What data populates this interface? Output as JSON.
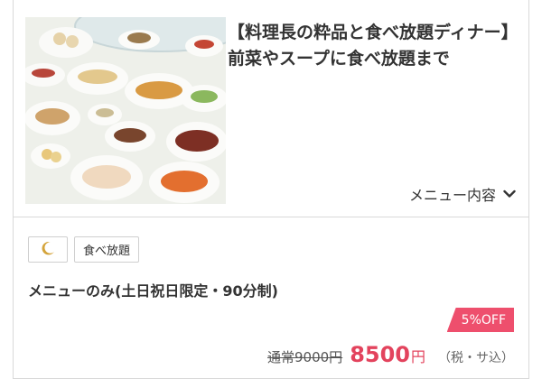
{
  "plan": {
    "photo_alt": "",
    "title_line1": "【料理長の粋品と食べ放題ディナー】",
    "title_line2": "前菜やスープに食べ放題まで",
    "menu_toggle_label": "メニュー内容"
  },
  "tags": {
    "moon_icon": "moon-icon",
    "buffet_label": "食べ放題"
  },
  "course": {
    "name": "メニューのみ(土日祝日限定・90分制)",
    "discount_badge": "5%OFF",
    "regular_price": "通常9000円",
    "price": "8500",
    "currency": "円",
    "tax_note": "（税・サ込）"
  },
  "colors": {
    "accent": "#ee4f6d",
    "price": "#e3435d",
    "moon": "#d4a43b"
  }
}
